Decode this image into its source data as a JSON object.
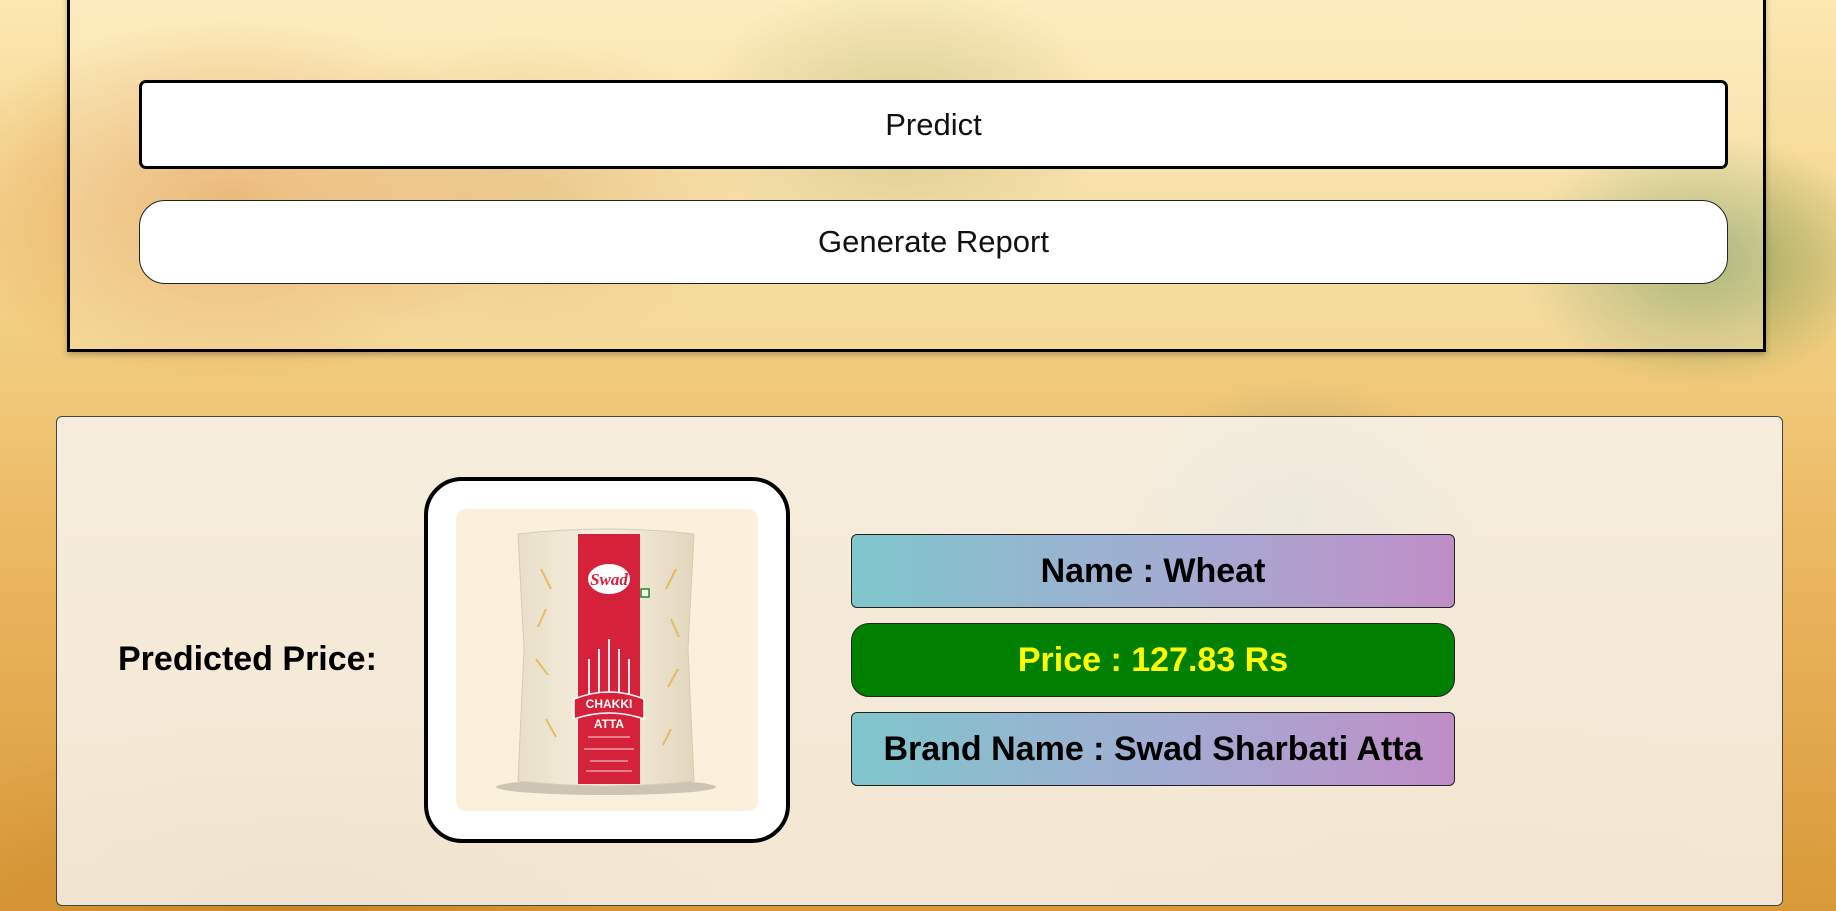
{
  "form": {
    "predict_label": "Predict",
    "report_label": "Generate Report"
  },
  "result": {
    "heading": "Predicted Price:",
    "name_text": "Name : Wheat",
    "price_text": "Price : 127.83 Rs",
    "brand_text": "Brand Name : Swad Sharbati Atta",
    "image_alt": "Swad Chakki Atta package"
  },
  "product_image": {
    "brand": "Swad",
    "line1": "CHAKKI",
    "line2": "ATTA"
  },
  "colors": {
    "price_bg": "#008000",
    "price_text": "#ffff00",
    "gradient_start": "#7fc6cc",
    "gradient_end": "#c08dc7",
    "package_red": "#d6213a"
  }
}
